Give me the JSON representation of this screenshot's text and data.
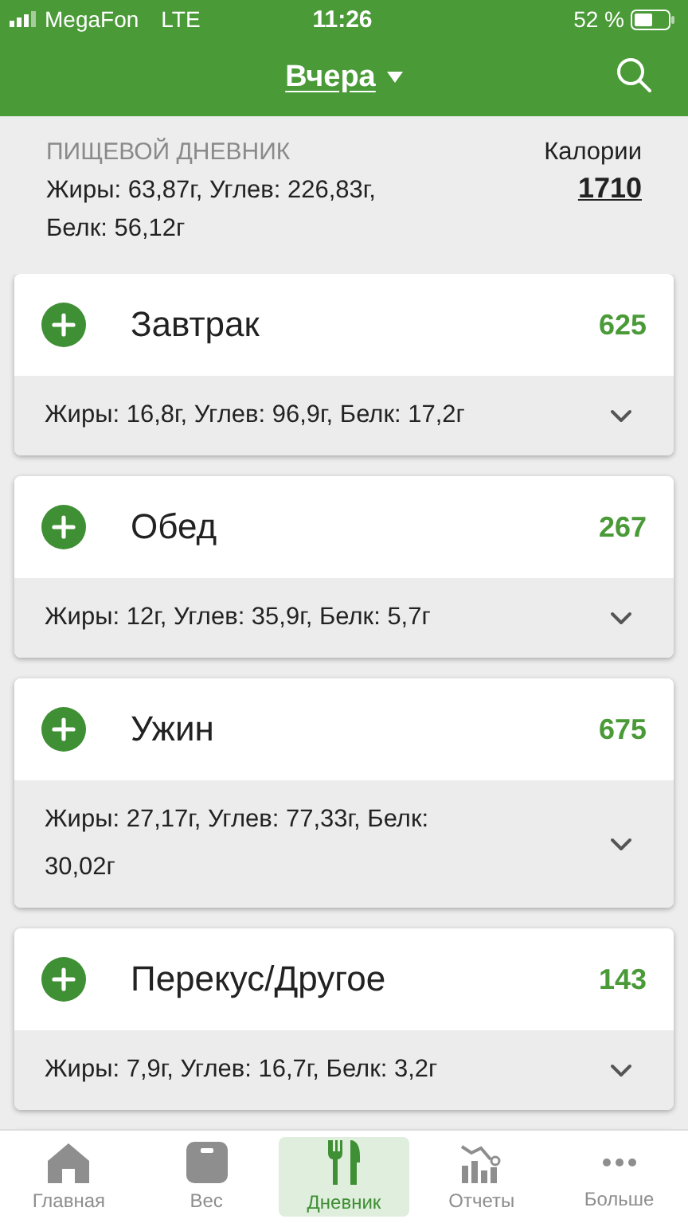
{
  "status_bar": {
    "carrier": "MegaFon",
    "network": "LTE",
    "time": "11:26",
    "battery": "52 %"
  },
  "header": {
    "title": "Вчера"
  },
  "summary": {
    "title": "ПИЩЕВОЙ ДНЕВНИК",
    "macros": "Жиры: 63,87г, Углев: 226,83г, Белк: 56,12г",
    "calories_label": "Калории",
    "calories": "1710"
  },
  "meals": [
    {
      "name": "Завтрак",
      "calories": "625",
      "macros": "Жиры: 16,8г, Углев: 96,9г, Белк: 17,2г"
    },
    {
      "name": "Обед",
      "calories": "267",
      "macros": "Жиры: 12г, Углев: 35,9г, Белк: 5,7г"
    },
    {
      "name": "Ужин",
      "calories": "675",
      "macros": "Жиры: 27,17г, Углев: 77,33г, Белк: 30,02г"
    },
    {
      "name": "Перекус/Другое",
      "calories": "143",
      "macros": "Жиры: 7,9г, Углев: 16,7г, Белк: 3,2г"
    }
  ],
  "tab_bar": [
    {
      "kind": "home",
      "label": "Главная",
      "selected": false
    },
    {
      "kind": "scale",
      "label": "Вес",
      "selected": false
    },
    {
      "kind": "diary",
      "label": "Дневник",
      "selected": true
    },
    {
      "kind": "reports",
      "label": "Отчеты",
      "selected": false
    },
    {
      "kind": "more",
      "label": "Больше",
      "selected": false
    }
  ]
}
